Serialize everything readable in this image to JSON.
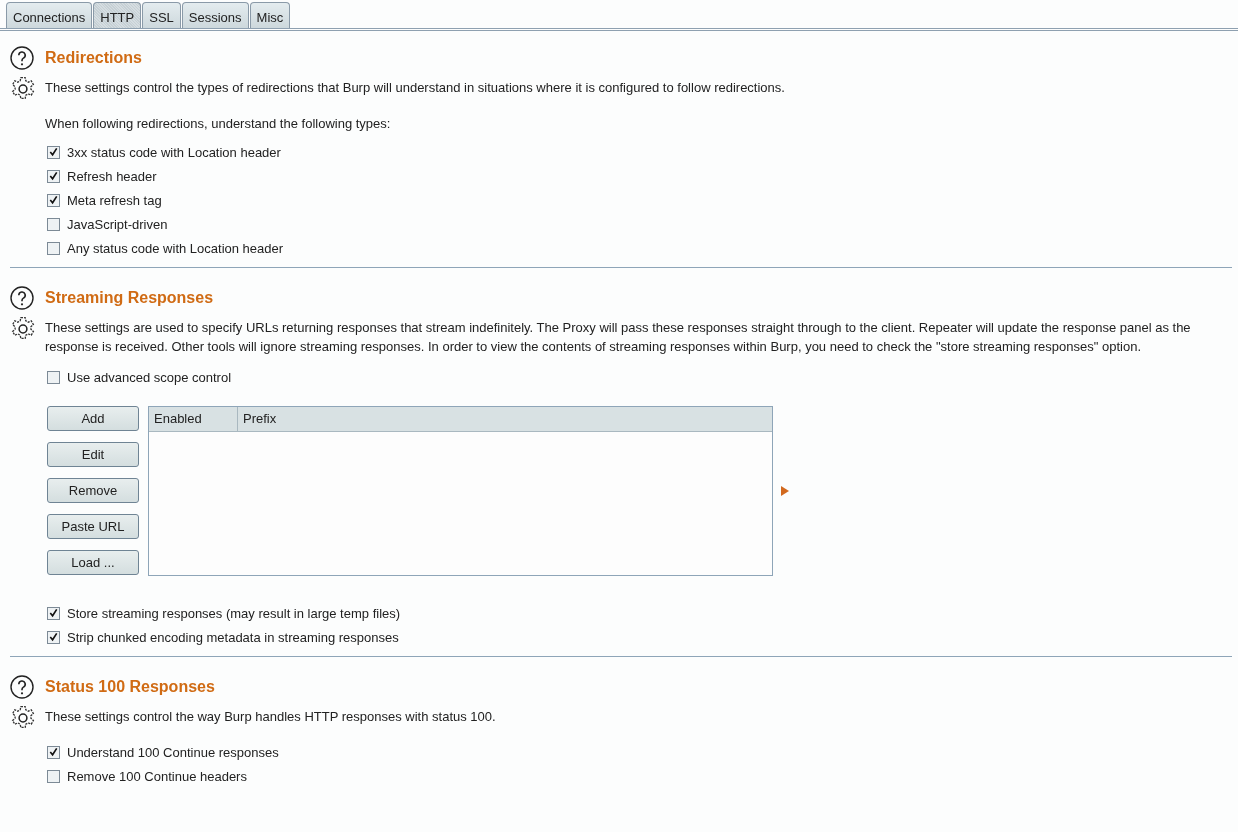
{
  "tabs": [
    {
      "label": "Connections",
      "selected": false
    },
    {
      "label": "HTTP",
      "selected": true
    },
    {
      "label": "SSL",
      "selected": false
    },
    {
      "label": "Sessions",
      "selected": false
    },
    {
      "label": "Misc",
      "selected": false
    }
  ],
  "sections": [
    {
      "title": "Redirections",
      "description": "These settings control the types of redirections that Burp will understand in situations where it is configured to follow redirections.",
      "blocks": [
        {
          "kind": "text",
          "text": "When following redirections, understand the following types:"
        },
        {
          "kind": "checkbox",
          "label": "3xx status code with Location header",
          "checked": true
        },
        {
          "kind": "checkbox",
          "label": "Refresh header",
          "checked": true
        },
        {
          "kind": "checkbox",
          "label": "Meta refresh tag",
          "checked": true
        },
        {
          "kind": "checkbox",
          "label": "JavaScript-driven",
          "checked": false
        },
        {
          "kind": "checkbox",
          "label": "Any status code with Location header",
          "checked": false
        }
      ]
    },
    {
      "title": "Streaming Responses",
      "description": "These settings are used to specify URLs returning responses that stream indefinitely. The Proxy will pass these responses straight through to the client. Repeater will update the response panel as the response is received. Other tools will ignore streaming responses. In order to view the contents of streaming responses within Burp, you need to check the \"store streaming responses\" option.",
      "blocks": [
        {
          "kind": "checkbox",
          "label": "Use advanced scope control",
          "checked": false
        },
        {
          "kind": "editor",
          "buttons": [
            "Add",
            "Edit",
            "Remove",
            "Paste URL",
            "Load ..."
          ],
          "columns": [
            "Enabled",
            "Prefix"
          ]
        },
        {
          "kind": "checkbox",
          "label": "Store streaming responses (may result in large temp files)",
          "checked": true
        },
        {
          "kind": "checkbox",
          "label": "Strip chunked encoding metadata in streaming responses",
          "checked": true
        }
      ]
    },
    {
      "title": "Status 100 Responses",
      "description": "These settings control the way Burp handles HTTP responses with status 100.",
      "blocks": [
        {
          "kind": "checkbox",
          "label": "Understand 100 Continue responses",
          "checked": true
        },
        {
          "kind": "checkbox",
          "label": "Remove 100 Continue headers",
          "checked": false
        }
      ]
    }
  ]
}
